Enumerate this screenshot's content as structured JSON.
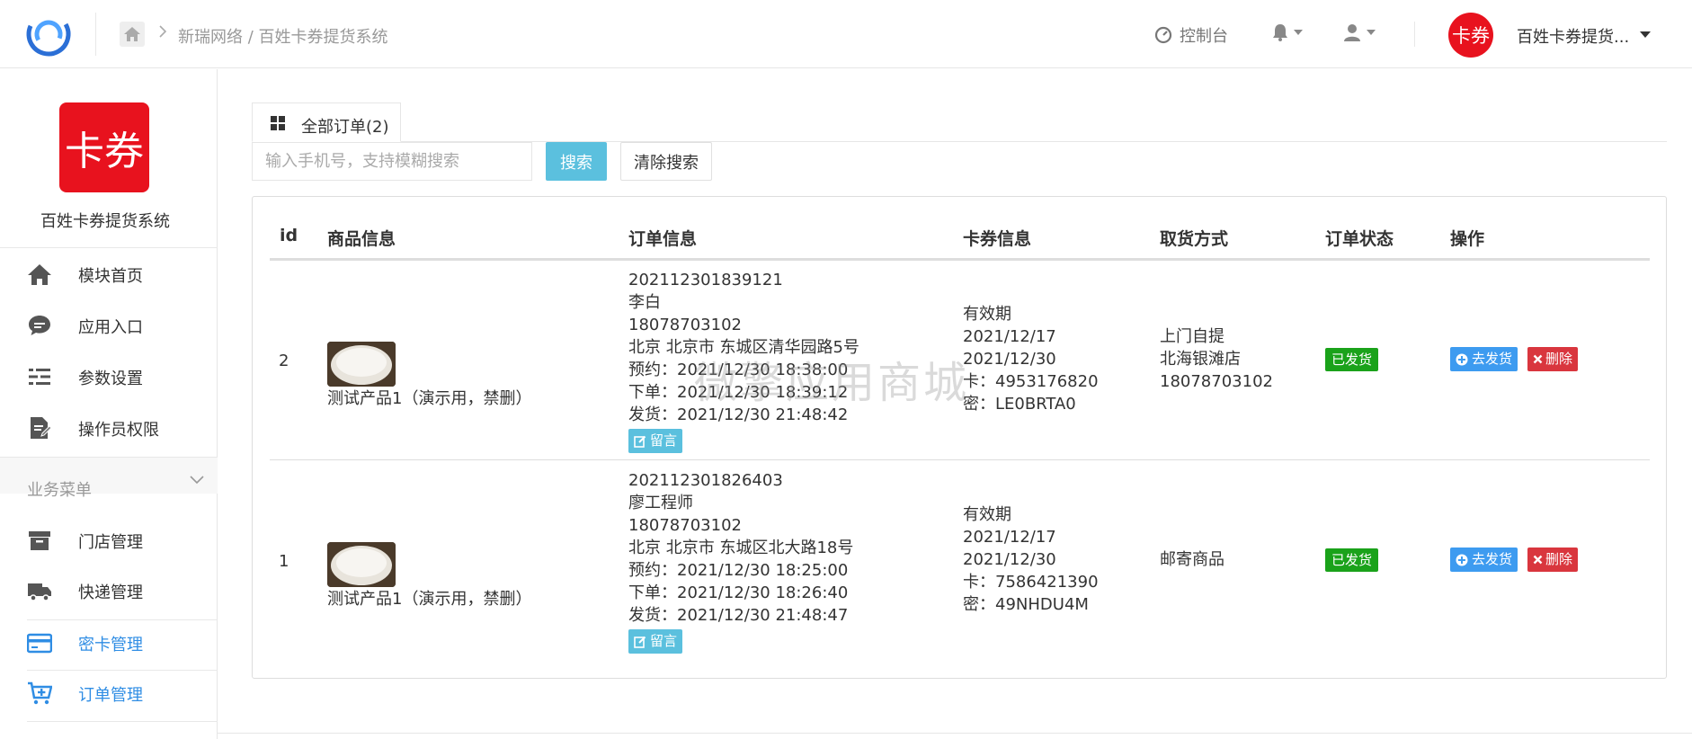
{
  "header": {
    "breadcrumb": "新瑞网络 / 百姓卡券提货系统",
    "console_label": "控制台",
    "avatar_text": "卡券",
    "account_name": "百姓卡券提货..."
  },
  "sidebar": {
    "app_logo_text": "卡券",
    "app_name": "百姓卡券提货系统",
    "items": [
      {
        "label": "模块首页",
        "icon": "home-icon"
      },
      {
        "label": "应用入口",
        "icon": "chat-icon"
      },
      {
        "label": "参数设置",
        "icon": "list-settings-icon"
      },
      {
        "label": "操作员权限",
        "icon": "document-edit-icon"
      }
    ],
    "group_label": "业务菜单",
    "group_items": [
      {
        "label": "门店管理",
        "icon": "archive-icon"
      },
      {
        "label": "快递管理",
        "icon": "truck-icon"
      },
      {
        "label": "密卡管理",
        "icon": "credit-card-icon"
      },
      {
        "label": "订单管理",
        "icon": "cart-add-icon"
      }
    ],
    "active_color": "#2f8de4"
  },
  "main": {
    "tab_label": "全部订单(2)",
    "search": {
      "placeholder": "输入手机号，支持模糊搜索",
      "value": "",
      "search_label": "搜索",
      "clear_label": "清除搜索"
    },
    "table": {
      "columns": [
        "id",
        "商品信息",
        "订单信息",
        "卡券信息",
        "取货方式",
        "订单状态",
        "操作"
      ],
      "rows": [
        {
          "id": "2",
          "product": "测试产品1（演示用，禁删）",
          "order_no": "202112301839121",
          "name": "李白",
          "phone": "18078703102",
          "address": "北京 北京市 东城区清华园路5号",
          "reserve": "预约：2021/12/30 18:38:00",
          "placed": "下单：2021/12/30 18:39:12",
          "shipped": "发货：2021/12/30 21:48:42",
          "msg_label": "留言",
          "card_validity_label": "有效期",
          "card_start": "2021/12/17",
          "card_end": "2021/12/30",
          "card_no": "卡：4953176820",
          "card_pwd": "密：LE0BRTA0",
          "pickup_lines": [
            "上门自提",
            "北海银滩店",
            "18078703102"
          ],
          "status": "已发货",
          "ship_label": "去发货",
          "delete_label": "删除"
        },
        {
          "id": "1",
          "product": "测试产品1（演示用，禁删）",
          "order_no": "202112301826403",
          "name": "廖工程师",
          "phone": "18078703102",
          "address": "北京 北京市 东城区北大路18号",
          "reserve": "预约：2021/12/30 18:25:00",
          "placed": "下单：2021/12/30 18:26:40",
          "shipped": "发货：2021/12/30 21:48:47",
          "msg_label": "留言",
          "card_validity_label": "有效期",
          "card_start": "2021/12/17",
          "card_end": "2021/12/30",
          "card_no": "卡：7586421390",
          "card_pwd": "密：49NHDU4M",
          "pickup_lines": [
            "邮寄商品"
          ],
          "status": "已发货",
          "ship_label": "去发货",
          "delete_label": "删除"
        }
      ]
    }
  },
  "watermark": "微擎应用商城",
  "colors": {
    "brand_red": "#e8121e",
    "status_green": "#1aa21a",
    "ship_blue": "#3d9bf0",
    "delete_red": "#d9363e",
    "info_cyan": "#5bc0de"
  }
}
